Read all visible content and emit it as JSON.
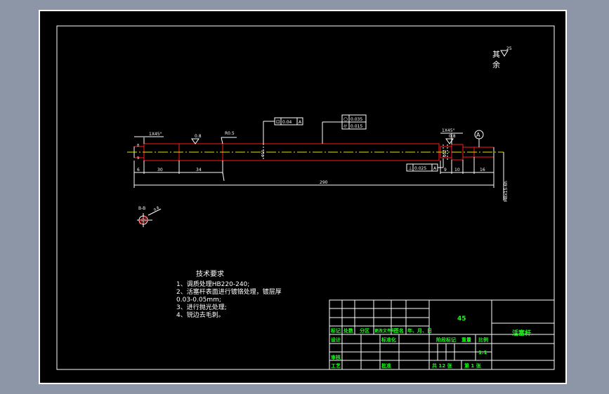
{
  "surface_note": {
    "line1": "其",
    "line2": "余",
    "roughness": "25"
  },
  "dims": {
    "chamfer_left": "1X45°",
    "chamfer_right": "1X45°",
    "rough_left": "0.8",
    "rough_right": "0.8",
    "radius": "R0.5",
    "d6": "6",
    "d30": "30",
    "d34": "34",
    "d290": "290",
    "d9": "9",
    "d10": "10",
    "d16": "16",
    "dia_right": "M8x15-6h",
    "dia_left_small": "8",
    "dia_left_big": "9",
    "dia_shaft": "Φ15",
    "dia_groove": "Φ12"
  },
  "gdt": {
    "top_left": {
      "symbol": "⊡",
      "value": "0.04",
      "datum": "A"
    },
    "top_right_1": {
      "symbol": "○",
      "value": "0.035"
    },
    "top_right_2": {
      "symbol": "⌭",
      "value": "0.015"
    },
    "bottom": {
      "symbol": "⊥",
      "value": "0.025",
      "datum": "A"
    },
    "datum_circle": "A"
  },
  "section": {
    "label": "B-B",
    "rough": "0.8"
  },
  "notes": {
    "title": "技术要求",
    "line1": "1、调质处理HB220-240;",
    "line2": "2、活塞杆表面进行镀铬处理，镀层厚",
    "line3": "0.03-0.05mm;",
    "line4": "3、进行抛光处理;",
    "line5": "4、锐边去毛刺。"
  },
  "title_block": {
    "material": "45",
    "part_name": "活塞杆",
    "h_mark": "标记",
    "h_count": "处数",
    "h_zone": "分区",
    "h_change": "更改文件号",
    "h_sign": "签名",
    "h_date": "年、月、日",
    "designer": "设计",
    "standard": "标准化",
    "review": "审核",
    "process": "工艺",
    "approve": "批准",
    "stage_mark": "阶段标记",
    "weight": "重量",
    "scale": "比例",
    "scale_value": "1:1",
    "total_sheets": "共  12  张",
    "sheet_no": "第  1  张"
  }
}
